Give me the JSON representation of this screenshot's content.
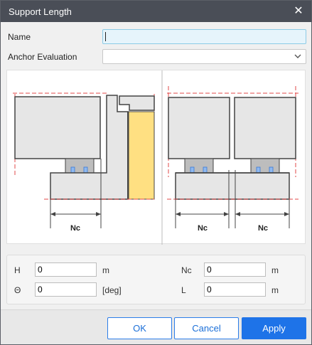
{
  "window": {
    "title": "Support Length",
    "close_icon": "close-icon"
  },
  "form": {
    "name_label": "Name",
    "name_value": "",
    "anchor_label": "Anchor Evaluation",
    "anchor_value": ""
  },
  "figure": {
    "left_dim_label": "Nc",
    "right_dim_label_1": "Nc",
    "right_dim_label_2": "Nc",
    "colors": {
      "grey_fill": "#e6e6e6",
      "outline": "#444444",
      "yellow": "#ffe082",
      "blue": "#8fb9f0",
      "red_dash": "#e04848"
    }
  },
  "params": {
    "h_label": "H",
    "h_value": "0",
    "h_unit": "m",
    "theta_label": "Θ",
    "theta_value": "0",
    "theta_unit": "[deg]",
    "nc_label": "Nc",
    "nc_value": "0",
    "nc_unit": "m",
    "l_label": "L",
    "l_value": "0",
    "l_unit": "m"
  },
  "buttons": {
    "ok": "OK",
    "cancel": "Cancel",
    "apply": "Apply"
  },
  "colors": {
    "titlebar": "#4a4e57",
    "accent": "#1e73e8"
  }
}
